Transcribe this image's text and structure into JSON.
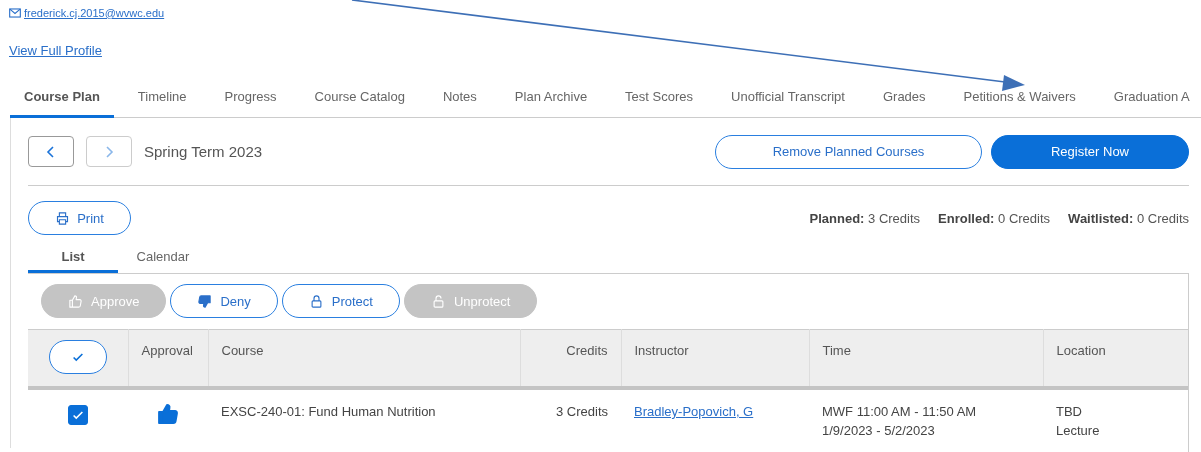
{
  "profile": {
    "email": "frederick.cj.2015@wvwc.edu",
    "profile_link": "View Full Profile"
  },
  "tabs": [
    {
      "label": "Course Plan",
      "selected": true
    },
    {
      "label": "Timeline",
      "selected": false
    },
    {
      "label": "Progress",
      "selected": false
    },
    {
      "label": "Course Catalog",
      "selected": false
    },
    {
      "label": "Notes",
      "selected": false
    },
    {
      "label": "Plan Archive",
      "selected": false
    },
    {
      "label": "Test Scores",
      "selected": false
    },
    {
      "label": "Unofficial Transcript",
      "selected": false
    },
    {
      "label": "Grades",
      "selected": false
    },
    {
      "label": "Petitions & Waivers",
      "selected": false
    },
    {
      "label": "Graduation A",
      "selected": false
    }
  ],
  "term": {
    "title": "Spring Term 2023",
    "prev_disabled": false,
    "next_disabled": true
  },
  "actions": [
    {
      "label": "Remove Planned Courses",
      "kind": "outline"
    },
    {
      "label": "Register Now",
      "kind": "primary"
    }
  ],
  "print": {
    "label": "Print"
  },
  "totals": [
    {
      "label": "Planned:",
      "value": "3 Credits"
    },
    {
      "label": "Enrolled:",
      "value": "0 Credits"
    },
    {
      "label": "Waitlisted:",
      "value": "0 Credits"
    }
  ],
  "view_tabs": [
    {
      "label": "List",
      "selected": true
    },
    {
      "label": "Calendar",
      "selected": false
    }
  ],
  "toolbar": [
    {
      "label": "Approve",
      "kind": "approve",
      "disabled": true
    },
    {
      "label": "Deny",
      "kind": "deny",
      "disabled": false
    },
    {
      "label": "Protect",
      "kind": "protect",
      "disabled": false
    },
    {
      "label": "Unprotect",
      "kind": "unprotect",
      "disabled": true
    }
  ],
  "table": {
    "columns": [
      "Approval",
      "Course",
      "Credits",
      "Instructor",
      "Time",
      "Location"
    ],
    "rows": [
      {
        "checked": true,
        "approved": true,
        "course": "EXSC-240-01: Fund Human Nutrition",
        "credits": "3 Credits",
        "instructor": "Bradley-Popovich, G",
        "time": [
          "MWF 11:00 AM - 11:50 AM",
          "1/9/2023 - 5/2/2023"
        ],
        "location": [
          "TBD",
          "Lecture"
        ]
      }
    ]
  }
}
